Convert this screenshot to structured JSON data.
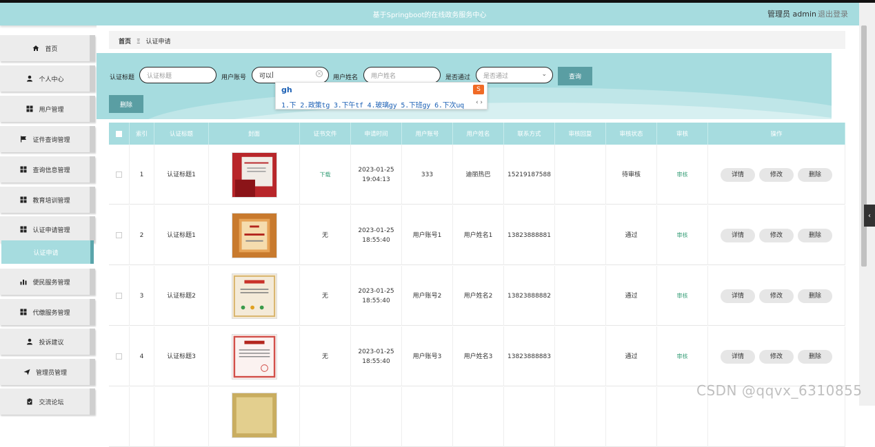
{
  "header": {
    "title": "基于Springboot的在线政务服务中心",
    "user": "管理员 admin",
    "logout": "退出登录"
  },
  "sidebar": {
    "items": [
      {
        "label": "首页",
        "icon": "home-icon"
      },
      {
        "label": "个人中心",
        "icon": "person-icon"
      },
      {
        "label": "用户管理",
        "icon": "grid-icon"
      },
      {
        "label": "证件查询管理",
        "icon": "flag-icon"
      },
      {
        "label": "查询信息管理",
        "icon": "grid-icon"
      },
      {
        "label": "教育培训管理",
        "icon": "grid-icon"
      },
      {
        "label": "认证申请管理",
        "icon": "grid-icon"
      },
      {
        "label": "便民服务管理",
        "icon": "bar-chart-icon"
      },
      {
        "label": "代缴服务管理",
        "icon": "grid-icon"
      },
      {
        "label": "投诉建议",
        "icon": "person-icon"
      },
      {
        "label": "管理员管理",
        "icon": "send-icon"
      },
      {
        "label": "交流论坛",
        "icon": "clipboard-icon"
      }
    ],
    "active_sub": "认证申请"
  },
  "breadcrumb": {
    "home": "首页",
    "sep": "Ξ",
    "current": "认证申请"
  },
  "search": {
    "title_label": "认证标题",
    "title_placeholder": "认证标题",
    "account_label": "用户账号",
    "account_value": "可以",
    "name_label": "用户姓名",
    "name_placeholder": "用户姓名",
    "passed_label": "是否通过",
    "passed_placeholder": "是否通过",
    "search_button": "查询",
    "delete_button": "删除"
  },
  "ime": {
    "code": "gh",
    "candidates": "1.下 2.政策tg 3.下午tf 4.玻璃gy 5.下班gy 6.下次uq"
  },
  "table": {
    "headers": [
      "索引",
      "认证标题",
      "封面",
      "证书文件",
      "申请时间",
      "用户账号",
      "用户姓名",
      "联系方式",
      "审核回复",
      "审核状态",
      "审核",
      "操作"
    ],
    "rows": [
      {
        "index": "1",
        "title": "认证标题1",
        "file": "下载",
        "time": "2023-01-25 19:04:13",
        "account": "333",
        "name": "迪丽热巴",
        "phone": "15219187588",
        "reply": "",
        "status": "待审核",
        "audit": "审核"
      },
      {
        "index": "2",
        "title": "认证标题1",
        "file": "无",
        "time": "2023-01-25 18:55:40",
        "account": "用户账号1",
        "name": "用户姓名1",
        "phone": "13823888881",
        "reply": "",
        "status": "通过",
        "audit": "审核"
      },
      {
        "index": "3",
        "title": "认证标题2",
        "file": "无",
        "time": "2023-01-25 18:55:40",
        "account": "用户账号2",
        "name": "用户姓名2",
        "phone": "13823888882",
        "reply": "",
        "status": "通过",
        "audit": "审核"
      },
      {
        "index": "4",
        "title": "认证标题3",
        "file": "无",
        "time": "2023-01-25 18:55:40",
        "account": "用户账号3",
        "name": "用户姓名3",
        "phone": "13823888883",
        "reply": "",
        "status": "通过",
        "audit": "审核"
      }
    ],
    "actions": {
      "detail": "详情",
      "edit": "修改",
      "delete": "删除"
    }
  },
  "watermark": "CSDN @qqvx_6310855"
}
